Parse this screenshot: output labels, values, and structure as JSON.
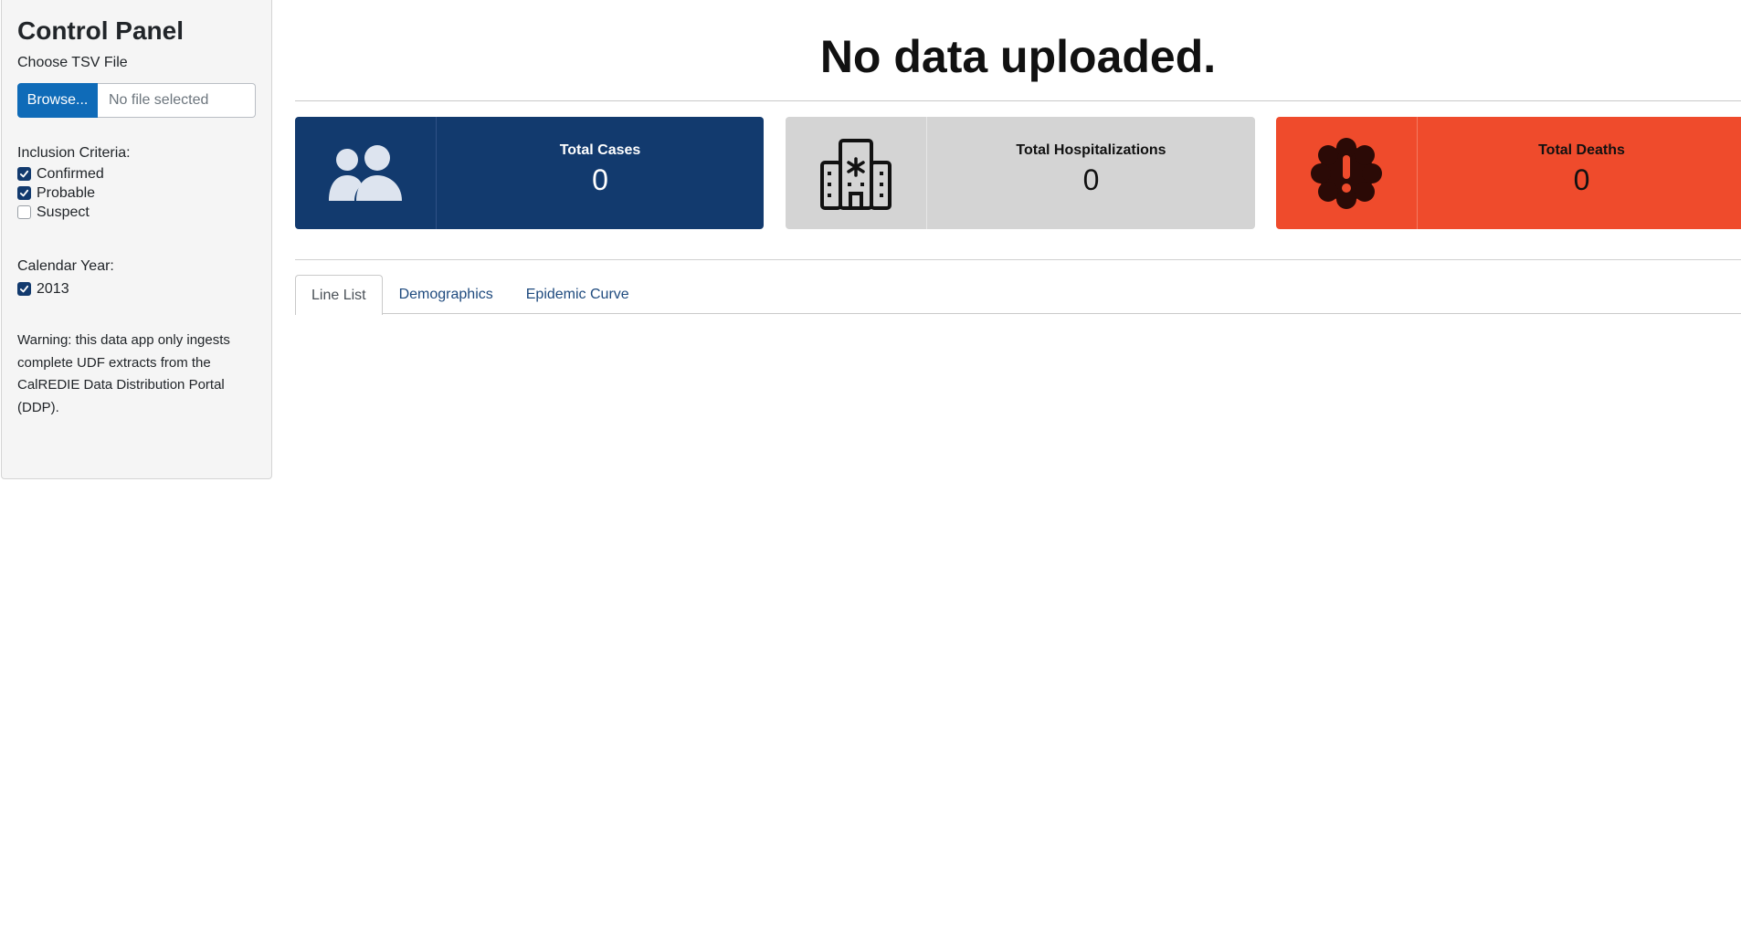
{
  "sidebar": {
    "title": "Control Panel",
    "file_label": "Choose TSV File",
    "browse_label": "Browse...",
    "file_placeholder": "No file selected",
    "inclusion_label": "Inclusion Criteria:",
    "inclusion_options": [
      {
        "label": "Confirmed",
        "checked": true
      },
      {
        "label": "Probable",
        "checked": true
      },
      {
        "label": "Suspect",
        "checked": false
      }
    ],
    "year_label": "Calendar Year:",
    "year_options": [
      {
        "label": "2013",
        "checked": true
      }
    ],
    "warning": "Warning: this data app only ingests complete UDF extracts from the CalREDIE Data Distribution Portal (DDP)."
  },
  "main": {
    "title": "No data uploaded.",
    "cards": {
      "cases": {
        "label": "Total Cases",
        "value": "0",
        "icon": "users-icon",
        "color": "#123a6e"
      },
      "hospitalizations": {
        "label": "Total Hospitalizations",
        "value": "0",
        "icon": "hospital-icon",
        "color": "#d4d4d4"
      },
      "deaths": {
        "label": "Total Deaths",
        "value": "0",
        "icon": "exclamation-burst-icon",
        "color": "#ef4b2c"
      }
    },
    "tabs": [
      {
        "label": "Line List",
        "active": true
      },
      {
        "label": "Demographics",
        "active": false
      },
      {
        "label": "Epidemic Curve",
        "active": false
      }
    ]
  }
}
